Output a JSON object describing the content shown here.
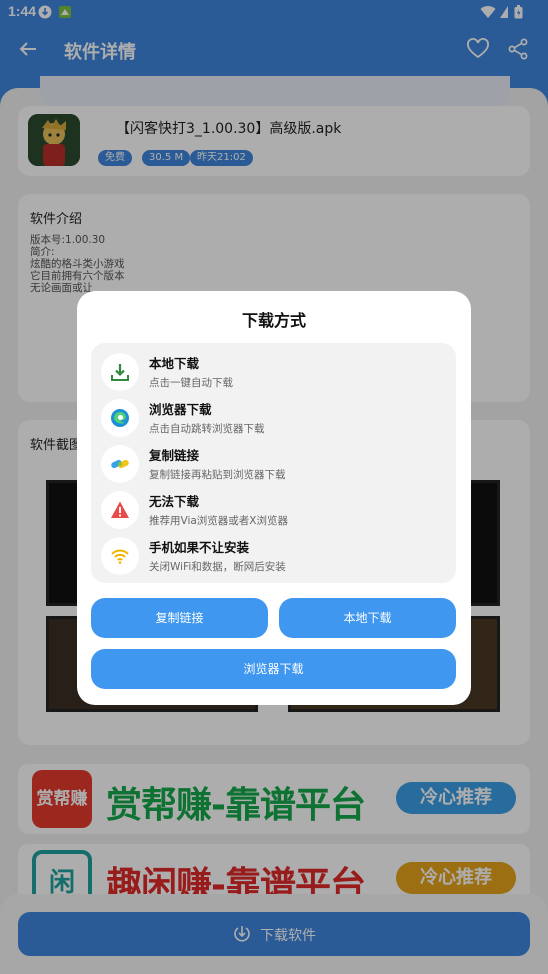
{
  "status_bar": {
    "time": "1:44"
  },
  "app_bar": {
    "title": "软件详情"
  },
  "app": {
    "name": "【闪客快打3_1.00.30】高级版.apk",
    "badges": [
      "免费",
      "30.5 M",
      "昨天21:02"
    ]
  },
  "intro": {
    "title": "软件介绍",
    "lines": [
      "版本号:1.00.30",
      "简介:",
      "炫酷的格斗类小游戏",
      "它目前拥有六个版本",
      "无论画面或让"
    ]
  },
  "screenshots": {
    "title": "软件截图"
  },
  "banners": [
    {
      "logo_text": "赏帮赚",
      "text": "赏帮赚-靠谱平台",
      "tag": "冷心推荐",
      "tag_color": "#3aa0e6"
    },
    {
      "logo_text": "闲",
      "text": "趣闲赚-靠谱平台",
      "tag": "冷心推荐",
      "tag_color": "#e8a41c"
    }
  ],
  "bottom": {
    "download_label": "下载软件"
  },
  "dialog": {
    "title": "下载方式",
    "options": [
      {
        "icon": "local-download-icon",
        "title": "本地下载",
        "subtitle": "点击一键自动下载"
      },
      {
        "icon": "edge-browser-icon",
        "title": "浏览器下载",
        "subtitle": "点击自动跳转浏览器下载"
      },
      {
        "icon": "link-icon",
        "title": "复制链接",
        "subtitle": "复制链接再粘贴到浏览器下载"
      },
      {
        "icon": "warning-icon",
        "title": "无法下载",
        "subtitle": "推荐用Via浏览器或者X浏览器"
      },
      {
        "icon": "wifi-icon",
        "title": "手机如果不让安装",
        "subtitle": "关闭WiFi和数据，断网后安装"
      }
    ],
    "buttons": {
      "copy_link": "复制链接",
      "local_download": "本地下载",
      "browser_download": "浏览器下载"
    }
  },
  "colors": {
    "primary": "#3f87df",
    "button": "#3f97ef",
    "banner_green": "#14a84a"
  }
}
